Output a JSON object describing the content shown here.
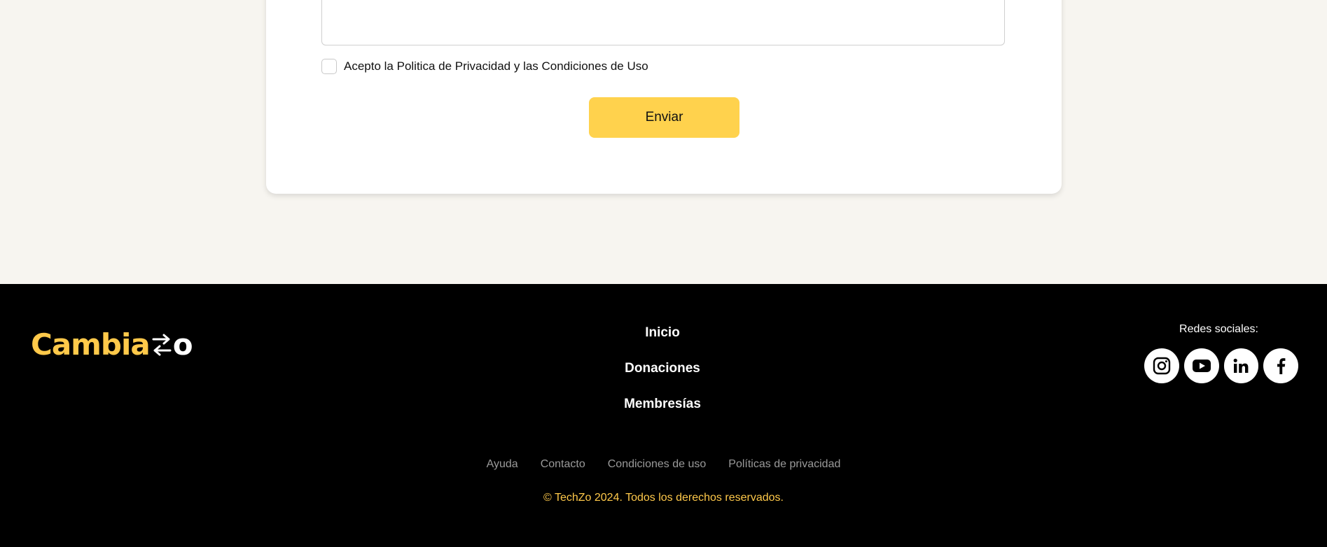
{
  "form": {
    "consent_label": "Acepto la Politica de Privacidad y las Condiciones de Uso",
    "submit_label": "Enviar"
  },
  "footer": {
    "logo": {
      "part1": "Cambia",
      "part2": "o",
      "colors": {
        "yellow": "#ffc94a",
        "white": "#ffffff"
      }
    },
    "nav": [
      {
        "label": "Inicio"
      },
      {
        "label": "Donaciones"
      },
      {
        "label": "Membresías"
      }
    ],
    "social_title": "Redes sociales:",
    "social": [
      {
        "icon": "instagram-icon"
      },
      {
        "icon": "youtube-icon"
      },
      {
        "icon": "linkedin-icon"
      },
      {
        "icon": "facebook-icon"
      }
    ],
    "legal_links": [
      {
        "label": "Ayuda"
      },
      {
        "label": "Contacto"
      },
      {
        "label": "Condiciones de uso"
      },
      {
        "label": "Políticas de privacidad"
      }
    ],
    "copyright": "© TechZo 2024. Todos los derechos reservados."
  },
  "colors": {
    "page_bg": "#f7f5f0",
    "accent": "#ffd24d",
    "footer_bg": "#000000",
    "muted_link": "#9a9a9a"
  }
}
